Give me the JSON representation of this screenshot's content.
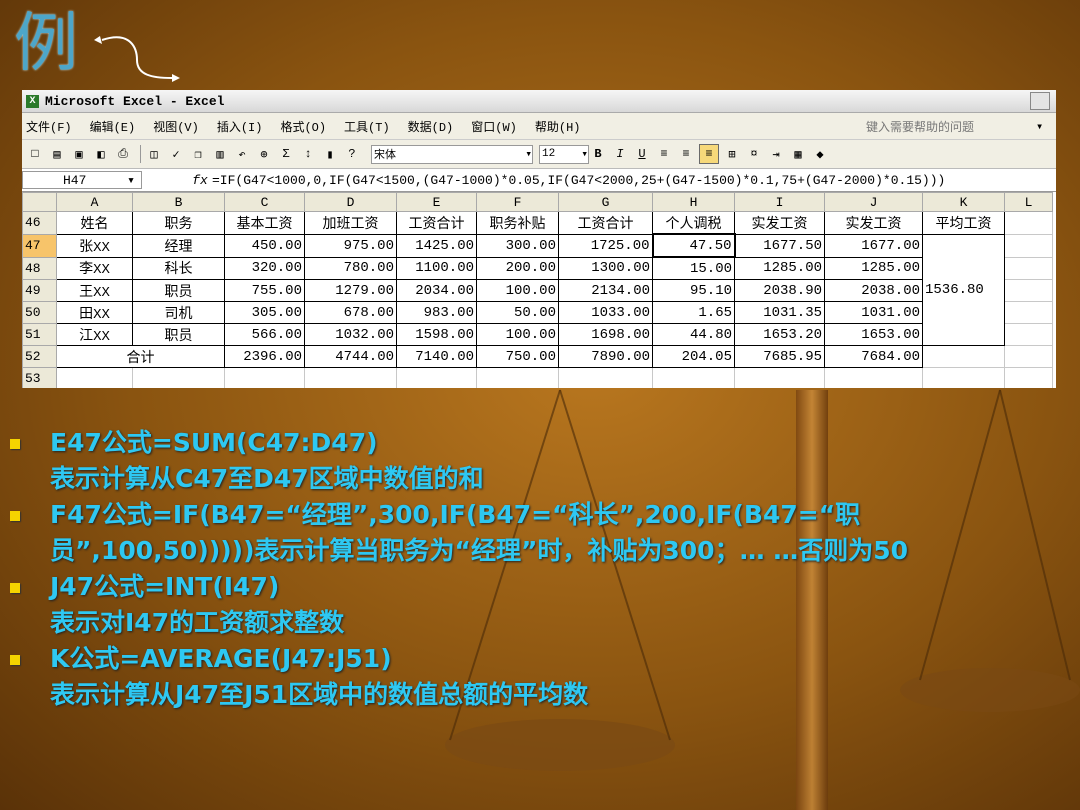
{
  "slide": {
    "title_glyph": "例",
    "excel": {
      "window_title": "Microsoft Excel - Excel",
      "menu": [
        "文件(F)",
        "编辑(E)",
        "视图(V)",
        "插入(I)",
        "格式(O)",
        "工具(T)",
        "数据(D)",
        "窗口(W)",
        "帮助(H)"
      ],
      "help_placeholder": "键入需要帮助的问题",
      "font_name": "宋体",
      "font_size": "12",
      "name_box": "H47",
      "formula": "=IF(G47<1000,0,IF(G47<1500,(G47-1000)*0.05,IF(G47<2000,25+(G47-1500)*0.1,75+(G47-2000)*0.15)))",
      "columns": [
        "A",
        "B",
        "C",
        "D",
        "E",
        "F",
        "G",
        "H",
        "I",
        "J",
        "K",
        "L"
      ],
      "headers": [
        "姓名",
        "职务",
        "基本工资",
        "加班工资",
        "工资合计",
        "职务补贴",
        "工资合计",
        "个人调税",
        "实发工资",
        "实发工资",
        "平均工资"
      ],
      "rows": [
        {
          "row": "47",
          "cells": [
            "张XX",
            "经理",
            "450.00",
            "975.00",
            "1425.00",
            "300.00",
            "1725.00",
            "47.50",
            "1677.50",
            "1677.00"
          ]
        },
        {
          "row": "48",
          "cells": [
            "李XX",
            "科长",
            "320.00",
            "780.00",
            "1100.00",
            "200.00",
            "1300.00",
            "15.00",
            "1285.00",
            "1285.00"
          ]
        },
        {
          "row": "49",
          "cells": [
            "王XX",
            "职员",
            "755.00",
            "1279.00",
            "2034.00",
            "100.00",
            "2134.00",
            "95.10",
            "2038.90",
            "2038.00"
          ]
        },
        {
          "row": "50",
          "cells": [
            "田XX",
            "司机",
            "305.00",
            "678.00",
            "983.00",
            "50.00",
            "1033.00",
            "1.65",
            "1031.35",
            "1031.00"
          ]
        },
        {
          "row": "51",
          "cells": [
            "江XX",
            "职员",
            "566.00",
            "1032.00",
            "1598.00",
            "100.00",
            "1698.00",
            "44.80",
            "1653.20",
            "1653.00"
          ]
        }
      ],
      "average_value": "1536.80",
      "total_row": {
        "row": "52",
        "label": "合计",
        "cells": [
          "2396.00",
          "4744.00",
          "7140.00",
          "750.00",
          "7890.00",
          "204.05",
          "7685.95",
          "7684.00"
        ]
      },
      "row_header_46": "46",
      "row_header_53": "53"
    },
    "bullets": [
      {
        "formula": "E47公式=SUM(C47:D47)",
        "desc": "表示计算从C47至D47区域中数值的和"
      },
      {
        "formula": "F47公式=IF(B47=“经理”,300,IF(B47=“科长”,200,IF(B47=“职员”,100,50)))))表示计算当职务为“经理”时，补贴为300；… …否则为50",
        "desc": ""
      },
      {
        "formula": "J47公式=INT(I47)",
        "desc": "表示对I47的工资额求整数"
      },
      {
        "formula": "K公式=AVERAGE(J47:J51)",
        "desc": "表示计算从J47至J51区域中的数值总额的平均数"
      }
    ]
  }
}
